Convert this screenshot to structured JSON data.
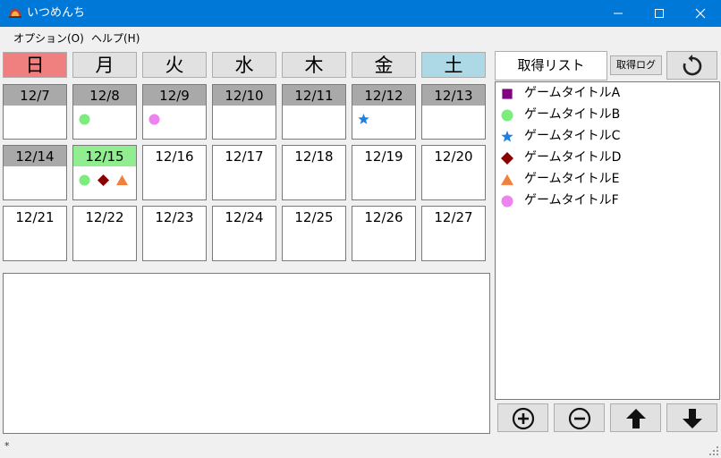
{
  "window": {
    "title": "いつめんち"
  },
  "menu": {
    "option": "オプション(O)",
    "help": "ヘルプ(H)"
  },
  "calendar": {
    "weekdays": [
      "日",
      "月",
      "火",
      "水",
      "木",
      "金",
      "土"
    ],
    "weeks": [
      [
        {
          "date": "12/7",
          "state": "past",
          "marks": []
        },
        {
          "date": "12/8",
          "state": "past",
          "marks": [
            "green-circle-icon"
          ]
        },
        {
          "date": "12/9",
          "state": "past",
          "marks": [
            "pink-circle-icon"
          ]
        },
        {
          "date": "12/10",
          "state": "past",
          "marks": []
        },
        {
          "date": "12/11",
          "state": "past",
          "marks": []
        },
        {
          "date": "12/12",
          "state": "past",
          "marks": [
            "blue-star-icon"
          ]
        },
        {
          "date": "12/13",
          "state": "past",
          "marks": []
        }
      ],
      [
        {
          "date": "12/14",
          "state": "past",
          "marks": []
        },
        {
          "date": "12/15",
          "state": "today",
          "marks": [
            "green-circle-icon",
            "dark-red-diamond-icon",
            "orange-triangle-icon"
          ]
        },
        {
          "date": "12/16",
          "state": "future",
          "marks": []
        },
        {
          "date": "12/17",
          "state": "future",
          "marks": []
        },
        {
          "date": "12/18",
          "state": "future",
          "marks": []
        },
        {
          "date": "12/19",
          "state": "future",
          "marks": []
        },
        {
          "date": "12/20",
          "state": "future",
          "marks": []
        }
      ],
      [
        {
          "date": "12/21",
          "state": "future",
          "marks": []
        },
        {
          "date": "12/22",
          "state": "future",
          "marks": []
        },
        {
          "date": "12/23",
          "state": "future",
          "marks": []
        },
        {
          "date": "12/24",
          "state": "future",
          "marks": []
        },
        {
          "date": "12/25",
          "state": "future",
          "marks": []
        },
        {
          "date": "12/26",
          "state": "future",
          "marks": []
        },
        {
          "date": "12/27",
          "state": "future",
          "marks": []
        }
      ]
    ]
  },
  "memo": {
    "text": ""
  },
  "right_panel": {
    "list_button": "取得リスト",
    "log_button": "取得ログ",
    "refresh_icon": "refresh-icon",
    "games": [
      {
        "name": "ゲームタイトルA",
        "icon": "purple-square-icon"
      },
      {
        "name": "ゲームタイトルB",
        "icon": "green-circle-icon"
      },
      {
        "name": "ゲームタイトルC",
        "icon": "blue-star-icon"
      },
      {
        "name": "ゲームタイトルD",
        "icon": "dark-red-diamond-icon"
      },
      {
        "name": "ゲームタイトルE",
        "icon": "orange-triangle-icon"
      },
      {
        "name": "ゲームタイトルF",
        "icon": "pink-circle-icon"
      }
    ],
    "controls": [
      "add-icon",
      "remove-icon",
      "arrow-up-icon",
      "arrow-down-icon"
    ]
  },
  "status": {
    "text": "*"
  },
  "colors": {
    "titlebar": "#0078d7",
    "sunday_header": "#f08080",
    "saturday_header": "#add8e6",
    "past_date": "#a9a9a9",
    "today_date": "#90ee90",
    "purple": "#800080",
    "green": "#7cec7c",
    "blue": "#1e7fe0",
    "dark_red": "#8b0000",
    "orange": "#f08040",
    "pink": "#ee82ee"
  }
}
